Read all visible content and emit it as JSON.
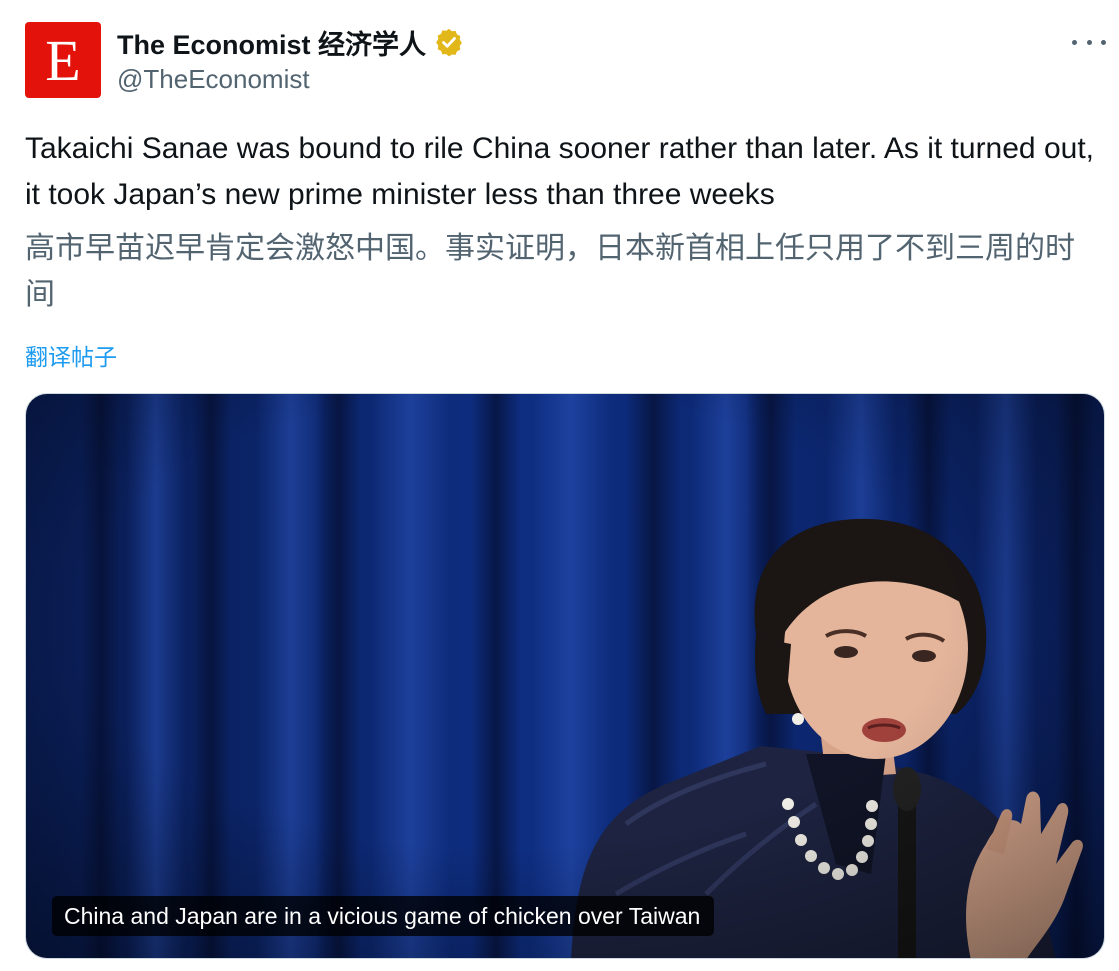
{
  "author": {
    "avatar_letter": "E",
    "display_name": "The Economist 经济学人",
    "handle": "@TheEconomist",
    "verified_icon": "verified-badge-icon",
    "verified_color": "#e2b719"
  },
  "menu": {
    "more_icon": "more-horizontal-icon"
  },
  "tweet": {
    "text": "Takaichi Sanae was bound to rile China sooner rather than later. As it turned out, it took Japan’s new prime minister less than three weeks",
    "translation": "高市早苗迟早肯定会激怒中国。事实证明，日本新首相上任只用了不到三周的时间",
    "translate_link": "翻译帖子"
  },
  "media": {
    "caption": "China and Japan are in a vicious game of chicken over Taiwan",
    "image_subject": "woman speaking at microphone before blue curtain"
  },
  "colors": {
    "avatar_bg": "#e3120b",
    "link": "#1d9bf0",
    "secondary_text": "#536471",
    "curtain": "#0d2a78"
  }
}
